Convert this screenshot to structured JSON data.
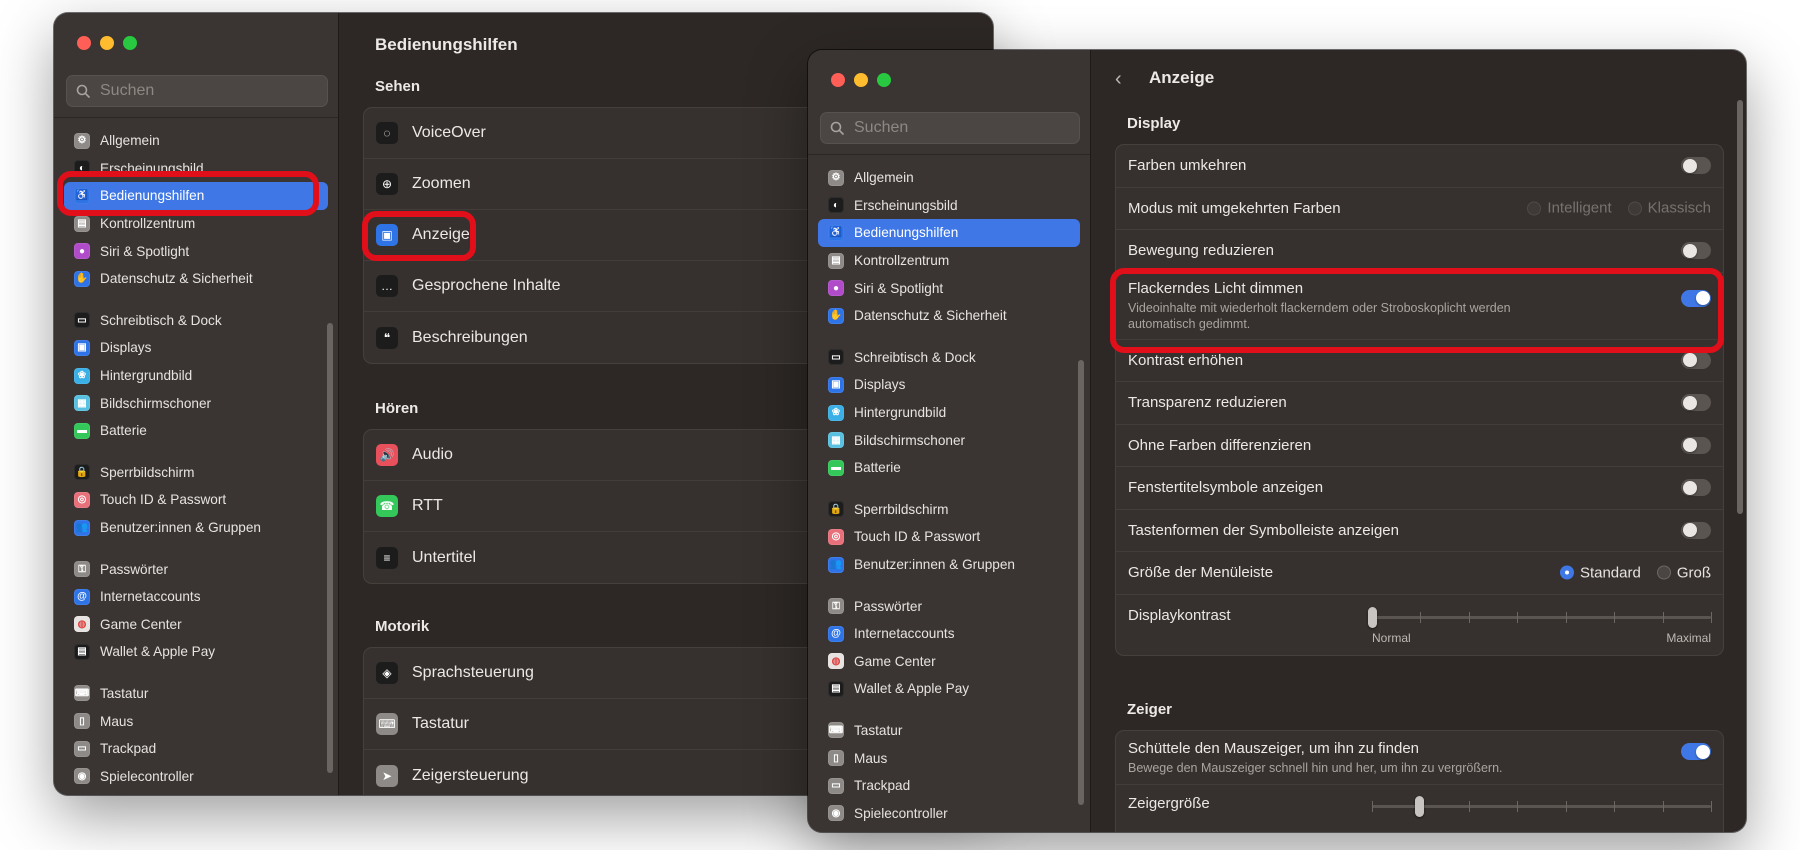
{
  "accent_color": "#3f78e6",
  "highlight_color": "#e00f1a",
  "window1": {
    "title": "Bedienungshilfen",
    "search_placeholder": "Suchen",
    "sidebar": [
      {
        "label": "Allgemein",
        "icon": "gear-icon",
        "color": "#8e8a87"
      },
      {
        "label": "Erscheinungsbild",
        "icon": "appearance-icon",
        "color": "#1c1c1c"
      },
      {
        "label": "Bedienungshilfen",
        "icon": "accessibility-icon",
        "color": "#2f74e6",
        "selected": true
      },
      {
        "label": "Kontrollzentrum",
        "icon": "control-center-icon",
        "color": "#8e8a87"
      },
      {
        "label": "Siri & Spotlight",
        "icon": "siri-icon",
        "color": "#b04cc9"
      },
      {
        "label": "Datenschutz & Sicherheit",
        "icon": "hand-icon",
        "color": "#2f74e6"
      },
      {
        "label": "Schreibtisch & Dock",
        "icon": "dock-icon",
        "color": "#1c1c1c",
        "group_start": true
      },
      {
        "label": "Displays",
        "icon": "display-icon",
        "color": "#2f74e6"
      },
      {
        "label": "Hintergrundbild",
        "icon": "wallpaper-icon",
        "color": "#3bb0e6"
      },
      {
        "label": "Bildschirmschoner",
        "icon": "screensaver-icon",
        "color": "#5ac0e0"
      },
      {
        "label": "Batterie",
        "icon": "battery-icon",
        "color": "#34c759"
      },
      {
        "label": "Sperrbildschirm",
        "icon": "lock-icon",
        "color": "#1c1c1c",
        "group_start": true
      },
      {
        "label": "Touch ID & Passwort",
        "icon": "fingerprint-icon",
        "color": "#e8707a"
      },
      {
        "label": "Benutzer:innen & Gruppen",
        "icon": "users-icon",
        "color": "#2f74e6"
      },
      {
        "label": "Passwörter",
        "icon": "key-icon",
        "color": "#8e8a87",
        "group_start": true
      },
      {
        "label": "Internetaccounts",
        "icon": "at-icon",
        "color": "#2f74e6"
      },
      {
        "label": "Game Center",
        "icon": "game-center-icon",
        "color": "#e6e3e1"
      },
      {
        "label": "Wallet & Apple Pay",
        "icon": "wallet-icon",
        "color": "#1c1c1c"
      },
      {
        "label": "Tastatur",
        "icon": "keyboard-icon",
        "color": "#8e8a87",
        "group_start": true
      },
      {
        "label": "Maus",
        "icon": "mouse-icon",
        "color": "#8e8a87"
      },
      {
        "label": "Trackpad",
        "icon": "trackpad-icon",
        "color": "#8e8a87"
      },
      {
        "label": "Spielecontroller",
        "icon": "gamepad-icon",
        "color": "#8e8a87"
      }
    ],
    "sections": [
      {
        "title": "Sehen",
        "items": [
          {
            "label": "VoiceOver",
            "icon": "voiceover-icon",
            "color": "#1c1c1c"
          },
          {
            "label": "Zoomen",
            "icon": "zoom-icon",
            "color": "#1c1c1c"
          },
          {
            "label": "Anzeige",
            "icon": "display-icon",
            "color": "#2f74e6"
          },
          {
            "label": "Gesprochene Inhalte",
            "icon": "speech-bubble-icon",
            "color": "#1c1c1c"
          },
          {
            "label": "Beschreibungen",
            "icon": "description-icon",
            "color": "#1c1c1c"
          }
        ]
      },
      {
        "title": "Hören",
        "items": [
          {
            "label": "Audio",
            "icon": "speaker-icon",
            "color": "#e8505b"
          },
          {
            "label": "RTT",
            "icon": "rtt-icon",
            "color": "#34c759"
          },
          {
            "label": "Untertitel",
            "icon": "captions-icon",
            "color": "#1c1c1c"
          }
        ]
      },
      {
        "title": "Motorik",
        "items": [
          {
            "label": "Sprachsteuerung",
            "icon": "voice-control-icon",
            "color": "#1c1c1c"
          },
          {
            "label": "Tastatur",
            "icon": "keyboard-icon",
            "color": "#8e8a87"
          },
          {
            "label": "Zeigersteuerung",
            "icon": "pointer-icon",
            "color": "#8e8a87"
          }
        ]
      }
    ]
  },
  "window2": {
    "title": "Anzeige",
    "search_placeholder": "Suchen",
    "sidebar": [
      {
        "label": "Allgemein",
        "icon": "gear-icon",
        "color": "#8e8a87"
      },
      {
        "label": "Erscheinungsbild",
        "icon": "appearance-icon",
        "color": "#1c1c1c"
      },
      {
        "label": "Bedienungshilfen",
        "icon": "accessibility-icon",
        "color": "#2f74e6",
        "selected": true
      },
      {
        "label": "Kontrollzentrum",
        "icon": "control-center-icon",
        "color": "#8e8a87"
      },
      {
        "label": "Siri & Spotlight",
        "icon": "siri-icon",
        "color": "#b04cc9"
      },
      {
        "label": "Datenschutz & Sicherheit",
        "icon": "hand-icon",
        "color": "#2f74e6"
      },
      {
        "label": "Schreibtisch & Dock",
        "icon": "dock-icon",
        "color": "#1c1c1c",
        "group_start": true
      },
      {
        "label": "Displays",
        "icon": "display-icon",
        "color": "#2f74e6"
      },
      {
        "label": "Hintergrundbild",
        "icon": "wallpaper-icon",
        "color": "#3bb0e6"
      },
      {
        "label": "Bildschirmschoner",
        "icon": "screensaver-icon",
        "color": "#5ac0e0"
      },
      {
        "label": "Batterie",
        "icon": "battery-icon",
        "color": "#34c759"
      },
      {
        "label": "Sperrbildschirm",
        "icon": "lock-icon",
        "color": "#1c1c1c",
        "group_start": true
      },
      {
        "label": "Touch ID & Passwort",
        "icon": "fingerprint-icon",
        "color": "#e8707a"
      },
      {
        "label": "Benutzer:innen & Gruppen",
        "icon": "users-icon",
        "color": "#2f74e6"
      },
      {
        "label": "Passwörter",
        "icon": "key-icon",
        "color": "#8e8a87",
        "group_start": true
      },
      {
        "label": "Internetaccounts",
        "icon": "at-icon",
        "color": "#2f74e6"
      },
      {
        "label": "Game Center",
        "icon": "game-center-icon",
        "color": "#e6e3e1"
      },
      {
        "label": "Wallet & Apple Pay",
        "icon": "wallet-icon",
        "color": "#1c1c1c"
      },
      {
        "label": "Tastatur",
        "icon": "keyboard-icon",
        "color": "#8e8a87",
        "group_start": true
      },
      {
        "label": "Maus",
        "icon": "mouse-icon",
        "color": "#8e8a87"
      },
      {
        "label": "Trackpad",
        "icon": "trackpad-icon",
        "color": "#8e8a87"
      },
      {
        "label": "Spielecontroller",
        "icon": "gamepad-icon",
        "color": "#8e8a87"
      }
    ],
    "display_section": {
      "title": "Display",
      "farben_umkehren": {
        "label": "Farben umkehren",
        "on": false
      },
      "modus": {
        "label": "Modus mit umgekehrten Farben",
        "option1": "Intelligent",
        "option2": "Klassisch"
      },
      "bewegung": {
        "label": "Bewegung reduzieren",
        "on": false
      },
      "flackern": {
        "label": "Flackerndes Licht dimmen",
        "on": true,
        "desc_line1": "Videoinhalte mit wiederholt flackerndem oder Stroboskoplicht werden",
        "desc_line2": "automatisch gedimmt."
      },
      "kontrast": {
        "label": "Kontrast erhöhen",
        "on": false
      },
      "transparenz": {
        "label": "Transparenz reduzieren",
        "on": false
      },
      "ohne_farben": {
        "label": "Ohne Farben differenzieren",
        "on": false
      },
      "fenstertitel": {
        "label": "Fenstertitelsymbole anzeigen",
        "on": false
      },
      "tastenformen": {
        "label": "Tastenformen der Symbolleiste anzeigen",
        "on": false
      },
      "menuleiste": {
        "label": "Größe der Menüleiste",
        "option1": "Standard",
        "option2": "Groß",
        "selected": "Standard"
      },
      "displaykontrast": {
        "label": "Displaykontrast",
        "min_label": "Normal",
        "max_label": "Maximal",
        "value": 0
      }
    },
    "zeiger_section": {
      "title": "Zeiger",
      "schuetteln": {
        "label": "Schüttele den Mauszeiger, um ihn zu finden",
        "on": true,
        "desc": "Bewege den Mauszeiger schnell hin und her, um ihn zu vergrößern."
      },
      "zeigergroesse": {
        "label": "Zeigergröße",
        "value": 0.14
      }
    }
  }
}
